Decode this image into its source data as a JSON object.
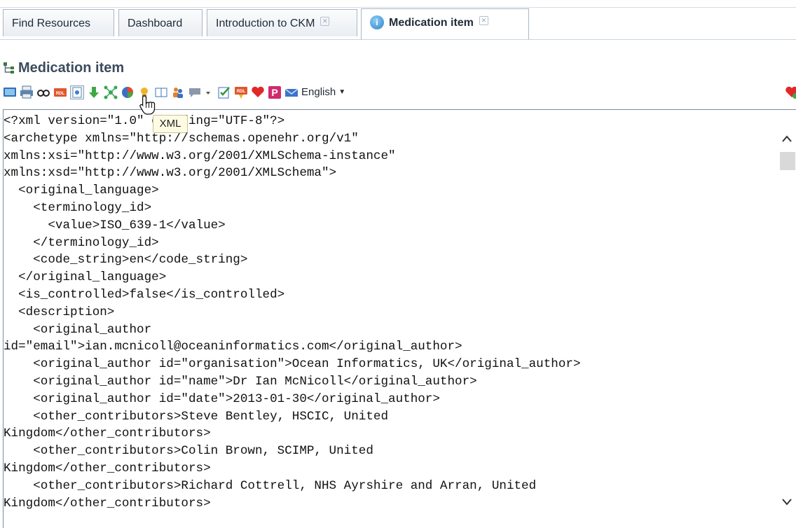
{
  "tabs": [
    {
      "label": "Find Resources"
    },
    {
      "label": "Dashboard"
    },
    {
      "label": "Introduction to CKM",
      "close": "✕"
    },
    {
      "label": "Medication item",
      "close": "✕",
      "icon": "info-icon",
      "active": true
    }
  ],
  "page": {
    "title": "Medication item",
    "title_icon": "tree-icon"
  },
  "toolbar": {
    "icons": [
      "monitor-icon",
      "print-icon",
      "glasses-icon",
      "rdl-icon",
      "xml-icon",
      "download-icon",
      "mindmap-icon",
      "pie-chart-icon",
      "idea-icon",
      "book-icon",
      "people-icon",
      "comment-icon",
      "checklist-icon",
      "rdl-upload-icon",
      "heart-icon",
      "p-icon",
      "email-icon"
    ],
    "language": "English",
    "tooltip": "XML"
  },
  "xml": {
    "lines": [
      "<?xml version=\"1.0\" encoding=\"UTF-8\"?>",
      "<archetype xmlns=\"http://schemas.openehr.org/v1\"",
      "xmlns:xsi=\"http://www.w3.org/2001/XMLSchema-instance\"",
      "xmlns:xsd=\"http://www.w3.org/2001/XMLSchema\">",
      "  <original_language>",
      "    <terminology_id>",
      "      <value>ISO_639-1</value>",
      "    </terminology_id>",
      "    <code_string>en</code_string>",
      "  </original_language>",
      "  <is_controlled>false</is_controlled>",
      "  <description>",
      "    <original_author",
      "id=\"email\">ian.mcnicoll@oceaninformatics.com</original_author>",
      "    <original_author id=\"organisation\">Ocean Informatics, UK</original_author>",
      "    <original_author id=\"name\">Dr Ian McNicoll</original_author>",
      "    <original_author id=\"date\">2013-01-30</original_author>",
      "    <other_contributors>Steve Bentley, HSCIC, United",
      "Kingdom</other_contributors>",
      "    <other_contributors>Colin Brown, SCIMP, United",
      "Kingdom</other_contributors>",
      "    <other_contributors>Richard Cottrell, NHS Ayrshire and Arran, United",
      "Kingdom</other_contributors>"
    ]
  },
  "colors": {
    "accent": "#2c7fc8",
    "title": "#3b4b5c",
    "tooltip_bg": "#fdfbe3"
  }
}
